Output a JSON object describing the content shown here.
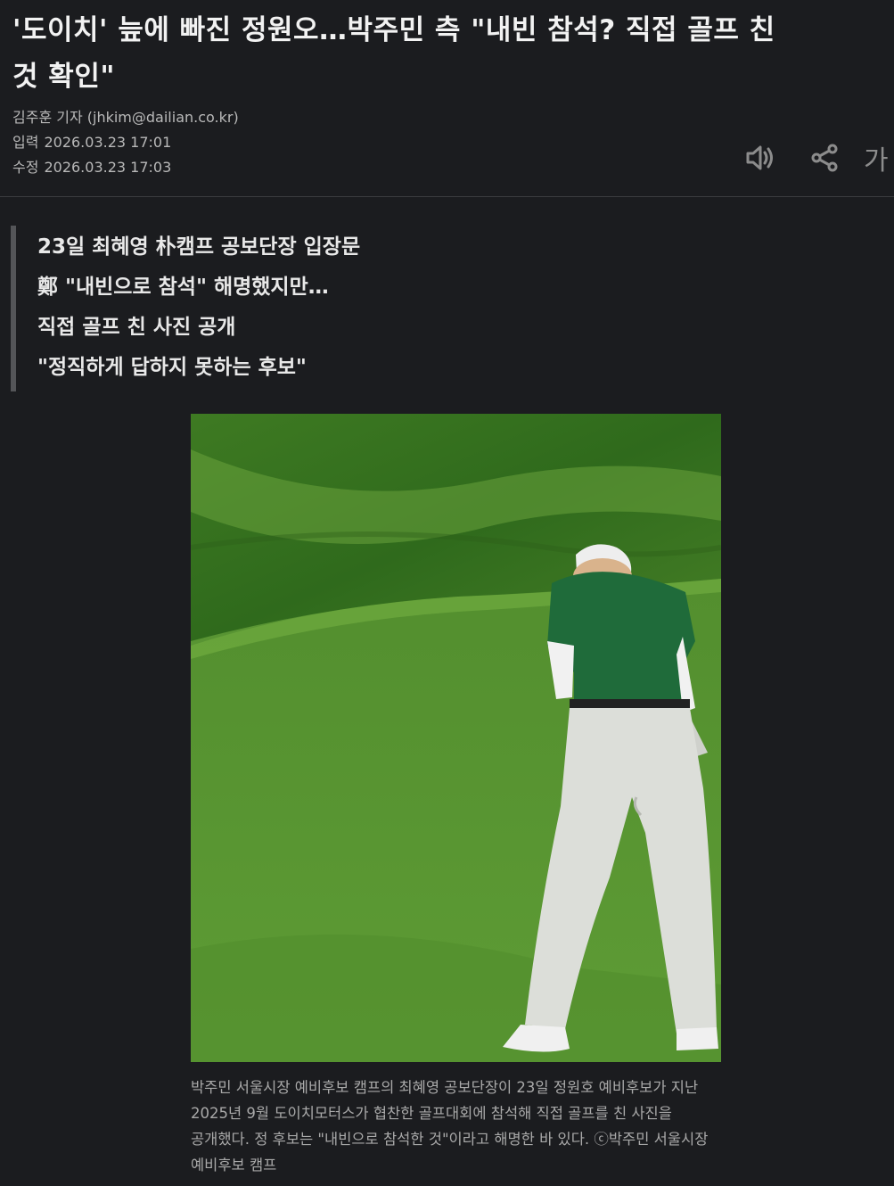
{
  "article": {
    "headline_line1": "'도이치' 늪에 빠진 정원오…박주민 측 \"내빈 참석? 직접 골프 친",
    "headline_line2": "것 확인\"",
    "reporter": "김주훈 기자 (jhkim@dailian.co.kr)",
    "published_label": "입력",
    "published": "2026.03.23 17:01",
    "modified_label": "수정",
    "modified": "2026.03.23 17:03"
  },
  "toolbar": {
    "speaker_icon": "speaker-icon",
    "share_icon": "share-icon",
    "font_size_label": "가"
  },
  "summary": [
    "23일 최혜영 朴캠프 공보단장 입장문",
    "鄭 \"내빈으로 참석\" 해명했지만…",
    "직접 골프 친 사진 공개",
    "\"정직하게 답하지 못하는 후보\""
  ],
  "photo": {
    "caption": "박주민 서울시장 예비후보 캠프의 최혜영 공보단장이 23일 정원호 예비후보가 지난 2025년 9월 도이치모터스가 협찬한 골프대회에 참석해 직접 골프를 친 사진을 공개했다. 정 후보는 \"내빈으로 참석한 것\"이라고 해명한 바 있다. ⓒ박주민 서울시장 예비후보 캠프"
  },
  "colors": {
    "background": "#1b1c1f",
    "grass": "#5a9531",
    "shirt": "#1f6b3a",
    "pants": "#d9dbd6"
  }
}
